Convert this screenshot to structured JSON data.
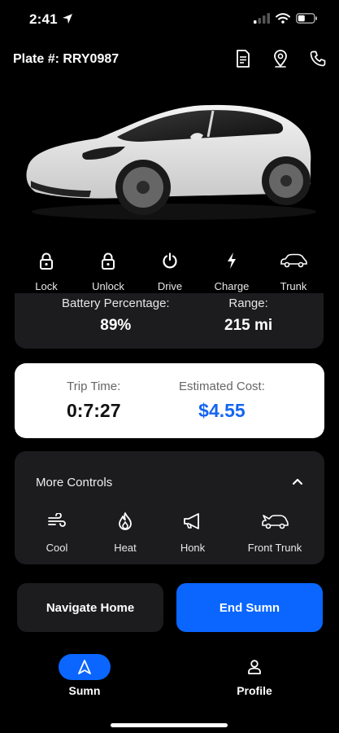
{
  "status_bar": {
    "time": "2:41"
  },
  "header": {
    "plate_label": "Plate #: RRY0987"
  },
  "quick_controls": [
    {
      "label": "Lock",
      "icon": "lock-icon"
    },
    {
      "label": "Unlock",
      "icon": "unlock-icon"
    },
    {
      "label": "Drive",
      "icon": "power-icon"
    },
    {
      "label": "Charge",
      "icon": "bolt-icon"
    },
    {
      "label": "Trunk",
      "icon": "car-trunk-icon"
    }
  ],
  "stats": {
    "battery_title": "Battery Percentage:",
    "battery_value": "89%",
    "range_title": "Range:",
    "range_value": "215 mi"
  },
  "trip": {
    "time_title": "Trip Time:",
    "time_value": "0:7:27",
    "cost_title": "Estimated Cost:",
    "cost_value": "$4.55"
  },
  "more_controls": {
    "title": "More Controls",
    "items": [
      {
        "label": "Cool",
        "icon": "fan-icon"
      },
      {
        "label": "Heat",
        "icon": "flame-icon"
      },
      {
        "label": "Honk",
        "icon": "horn-icon"
      },
      {
        "label": "Front Trunk",
        "icon": "car-frunk-icon"
      }
    ]
  },
  "actions": {
    "navigate_label": "Navigate Home",
    "end_label": "End Sumn"
  },
  "tabs": [
    {
      "label": "Sumn",
      "icon": "navigation-arrow-icon",
      "active": true
    },
    {
      "label": "Profile",
      "icon": "person-icon",
      "active": false
    }
  ],
  "colors": {
    "accent": "#0a66ff",
    "card": "#1c1c1e",
    "background": "#000000",
    "cost": "#1565f0"
  }
}
